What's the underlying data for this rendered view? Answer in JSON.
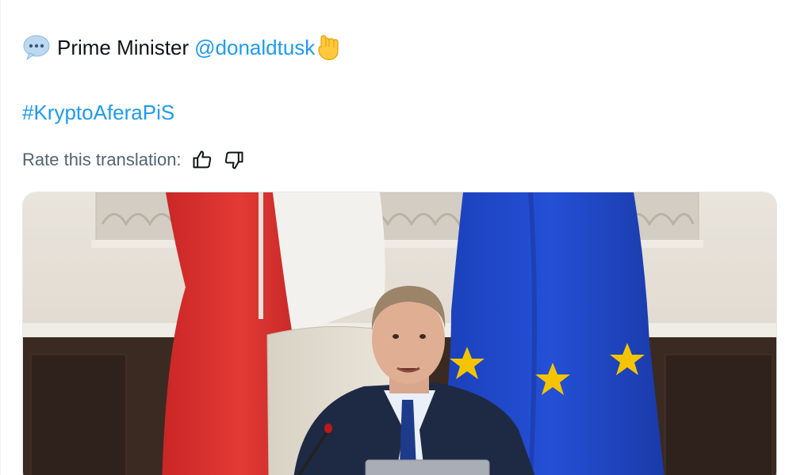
{
  "post": {
    "prefix": "Prime Minister",
    "mention": "@donaldtusk",
    "speech_icon": "speech-balloon-emoji",
    "hand_icon": "backhand-index-pointing-down-emoji",
    "hashtag": "#KryptoAferaPiS"
  },
  "translation": {
    "rate_label": "Rate this translation:",
    "thumbs_up_icon": "thumbs-up-icon",
    "thumbs_down_icon": "thumbs-down-icon"
  },
  "media": {
    "type": "video-thumbnail",
    "subjects": [
      "polish-flag",
      "eu-flag",
      "speaker-at-desk",
      "microphone",
      "laptop"
    ]
  },
  "colors": {
    "link": "#1d9bf0",
    "muted_text": "#536471",
    "text": "#0f1419",
    "eu_blue": "#1f47c8",
    "eu_star": "#f5c400",
    "pl_red": "#d92b2b"
  }
}
